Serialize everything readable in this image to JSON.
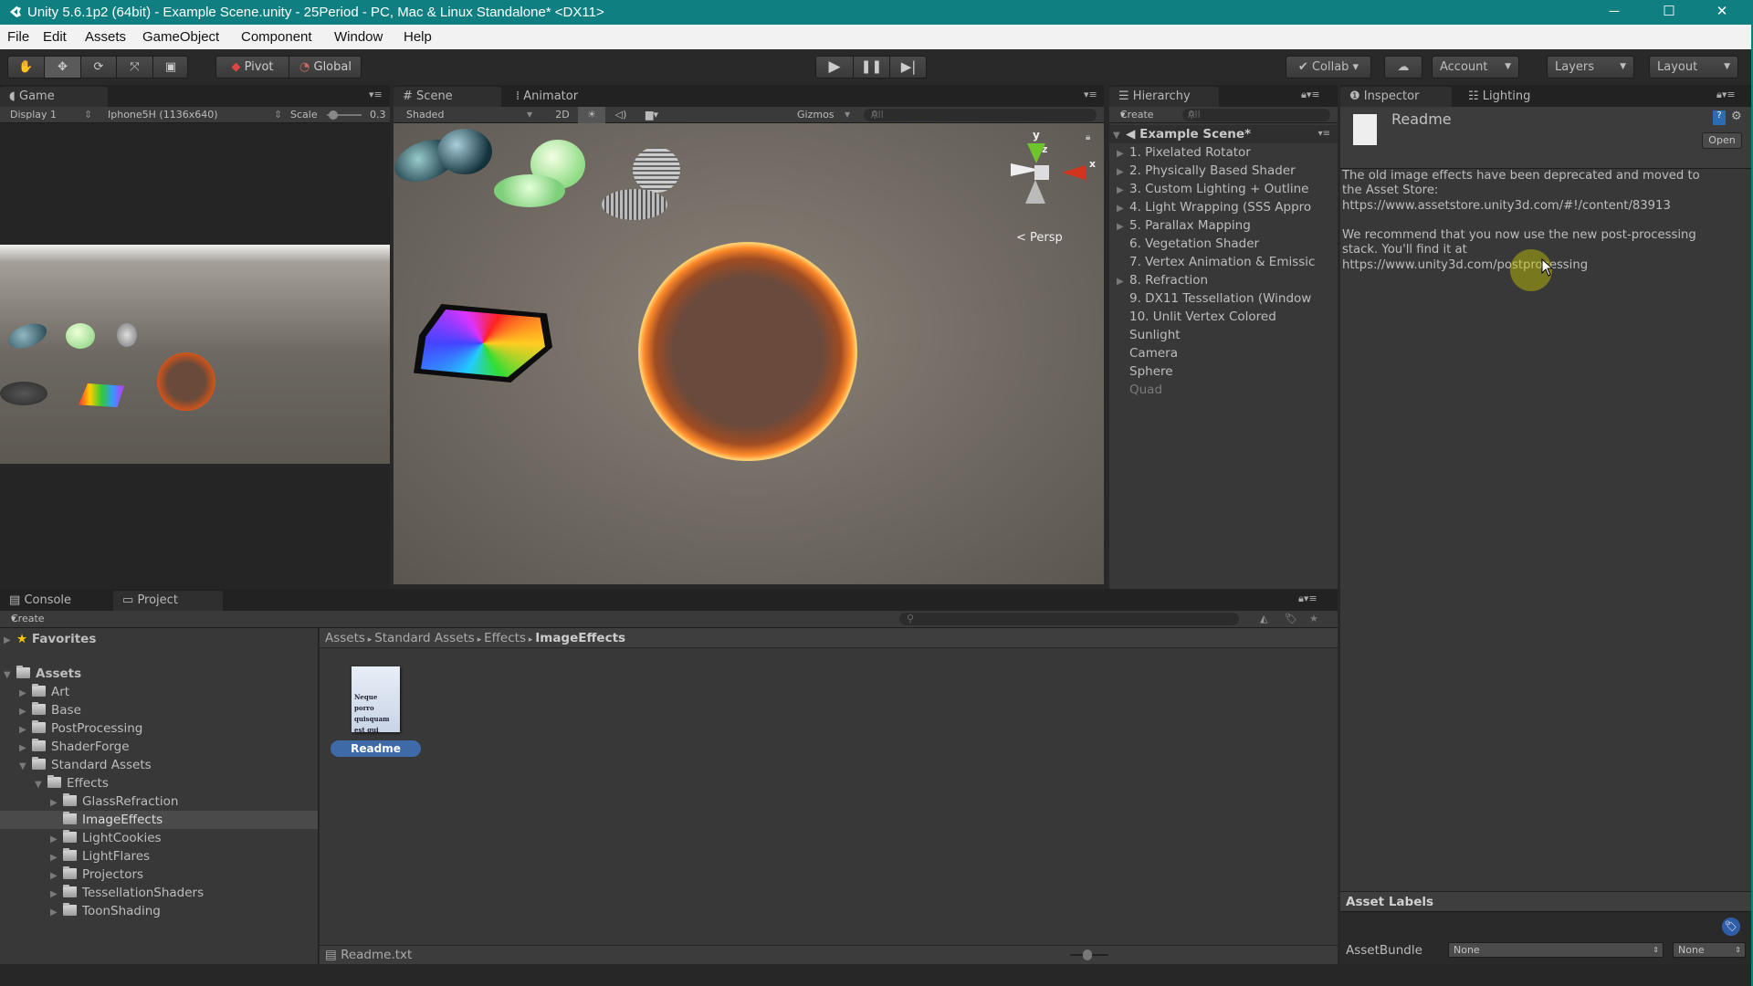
{
  "window": {
    "title": "Unity 5.6.1p2 (64bit) - Example Scene.unity - 25Period - PC, Mac & Linux Standalone* <DX11>",
    "minimize": "─",
    "maximize": "☐",
    "close": "✕"
  },
  "menu": [
    "File",
    "Edit",
    "Assets",
    "GameObject",
    "Component",
    "Window",
    "Help"
  ],
  "toolbar": {
    "tools": [
      "hand-icon",
      "move-icon",
      "rotate-icon",
      "scale-icon",
      "rect-icon"
    ],
    "pivot": "Pivot",
    "global": "Global",
    "collab": "Collab ▾",
    "account": "Account",
    "layers": "Layers",
    "layout": "Layout"
  },
  "game": {
    "tab": "Game",
    "display": "Display 1",
    "resolution": "Iphone5H (1136x640)",
    "scale_label": "Scale",
    "scale_value": "0.3"
  },
  "scene": {
    "tab": "Scene",
    "animator_tab": "Animator",
    "shading": "Shaded",
    "mode_2d": "2D",
    "gizmos": "Gizmos",
    "search_placeholder": "All",
    "persp": "Persp",
    "axis_y": "y",
    "axis_z": "z",
    "axis_x": "x"
  },
  "hierarchy": {
    "tab": "Hierarchy",
    "create": "Create",
    "search_placeholder": "All",
    "scene_name": "Example Scene*",
    "items": [
      {
        "label": "1. Pixelated Rotator",
        "expandable": true
      },
      {
        "label": "2. Physically Based Shader",
        "expandable": true
      },
      {
        "label": "3. Custom Lighting + Outline",
        "expandable": true
      },
      {
        "label": "4. Light Wrapping (SSS Appro",
        "expandable": true
      },
      {
        "label": "5. Parallax Mapping",
        "expandable": true
      },
      {
        "label": "6. Vegetation Shader",
        "expandable": false
      },
      {
        "label": "7. Vertex Animation & Emissic",
        "expandable": false
      },
      {
        "label": "8. Refraction",
        "expandable": true
      },
      {
        "label": "9. DX11 Tessellation (Window",
        "expandable": false
      },
      {
        "label": "10. Unlit Vertex Colored",
        "expandable": false
      },
      {
        "label": "Sunlight",
        "expandable": false
      },
      {
        "label": "Camera",
        "expandable": false
      },
      {
        "label": "Sphere",
        "expandable": false
      },
      {
        "label": "Quad",
        "expandable": false,
        "disabled": true
      }
    ]
  },
  "inspector": {
    "tab": "Inspector",
    "lighting_tab": "Lighting",
    "asset_name": "Readme",
    "open": "Open",
    "text_lines": [
      "The old image effects have been deprecated and moved to",
      "the Asset Store:",
      "https://www.assetstore.unity3d.com/#!/content/83913",
      "",
      "We recommend that you now use the new post-processing",
      "stack. You'll find it at",
      "https://www.unity3d.com/postprocessing"
    ],
    "asset_labels": "Asset Labels",
    "asset_bundle_label": "AssetBundle",
    "asset_bundle_value": "None",
    "asset_variant_value": "None"
  },
  "bottom": {
    "console_tab": "Console",
    "project_tab": "Project",
    "create": "Create",
    "favorites": "Favorites",
    "tree": [
      {
        "label": "Assets",
        "depth": 0,
        "state": "open",
        "bold": true
      },
      {
        "label": "Art",
        "depth": 1,
        "state": "closed"
      },
      {
        "label": "Base",
        "depth": 1,
        "state": "closed"
      },
      {
        "label": "PostProcessing",
        "depth": 1,
        "state": "closed"
      },
      {
        "label": "ShaderForge",
        "depth": 1,
        "state": "closed"
      },
      {
        "label": "Standard Assets",
        "depth": 1,
        "state": "open"
      },
      {
        "label": "Effects",
        "depth": 2,
        "state": "open"
      },
      {
        "label": "GlassRefraction",
        "depth": 3,
        "state": "closed"
      },
      {
        "label": "ImageEffects",
        "depth": 3,
        "state": "none",
        "selected": true
      },
      {
        "label": "LightCookies",
        "depth": 3,
        "state": "closed"
      },
      {
        "label": "LightFlares",
        "depth": 3,
        "state": "closed"
      },
      {
        "label": "Projectors",
        "depth": 3,
        "state": "closed"
      },
      {
        "label": "TessellationShaders",
        "depth": 3,
        "state": "closed"
      },
      {
        "label": "ToonShading",
        "depth": 3,
        "state": "closed"
      }
    ],
    "breadcrumb": [
      "Assets",
      "Standard Assets",
      "Effects",
      "ImageEffects"
    ],
    "file_label": "Readme",
    "file_preview_text": "Neque porro quisquam est qui dolorem.",
    "selected_path": "Readme.txt"
  },
  "colors": {
    "titlebar": "#0f7f82",
    "selection": "#3e6aa8",
    "cursor_highlight": "#c8c800"
  }
}
